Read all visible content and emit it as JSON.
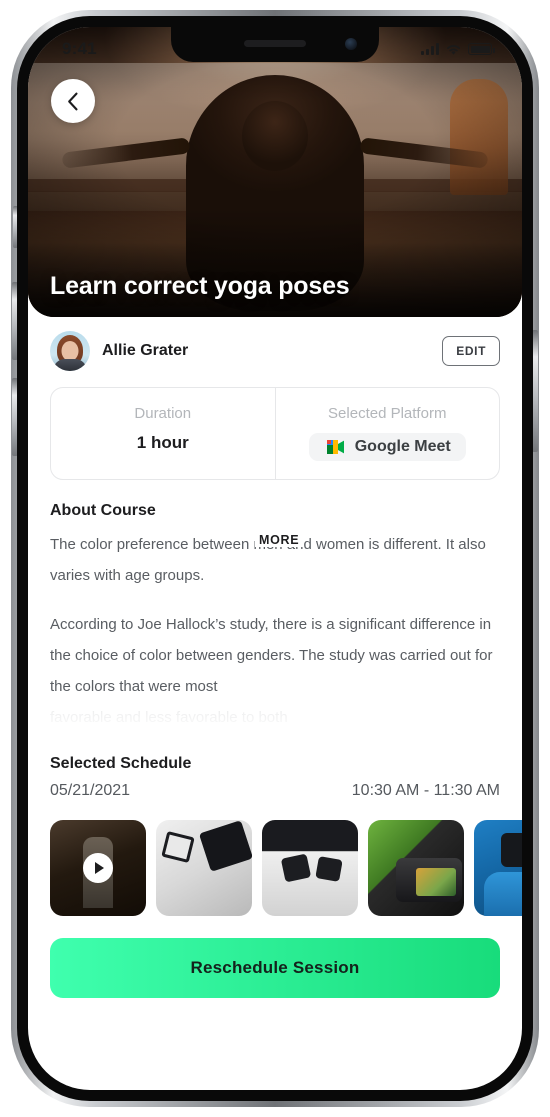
{
  "statusbar": {
    "time": "9:41",
    "signal_icon": "cellular-bars-icon",
    "wifi_icon": "wifi-icon",
    "battery_icon": "battery-full-icon"
  },
  "hero": {
    "title": "Learn correct yoga poses",
    "back_icon": "chevron-left-icon",
    "image_alt": "yoga-meditation-silhouette"
  },
  "instructor": {
    "name": "Allie Grater",
    "avatar_icon": "avatar",
    "edit_label": "EDIT"
  },
  "info_cards": [
    {
      "label": "Duration",
      "value": "1 hour"
    },
    {
      "label": "Selected Platform",
      "value": "Google Meet",
      "icon": "google-meet-icon"
    }
  ],
  "about": {
    "heading": "About Course",
    "paragraph_1": "The color preference between men and women is different. It also varies with age groups.",
    "paragraph_2": "According to Joe Hallock’s study, there is a significant difference in the choice of color between genders. The study was carried out for the colors that were most",
    "paragraph_3_faded": "favorable and less favorable to both",
    "more_label": "MORE"
  },
  "schedule": {
    "heading": "Selected Schedule",
    "date": "05/21/2021",
    "time": "10:30 AM - 11:30 AM"
  },
  "gallery": {
    "items": [
      {
        "name": "video-thumbnail",
        "has_play": true
      },
      {
        "name": "studio-lighting-thumbnail",
        "has_play": false
      },
      {
        "name": "studio-setup-thumbnail",
        "has_play": false
      },
      {
        "name": "camera-closeup-thumbnail",
        "has_play": false
      },
      {
        "name": "photographer-thumbnail",
        "has_play": false
      }
    ]
  },
  "cta": {
    "label": "Reschedule Session",
    "gradient_start": "#3FFFAE",
    "gradient_end": "#18DC7B"
  }
}
